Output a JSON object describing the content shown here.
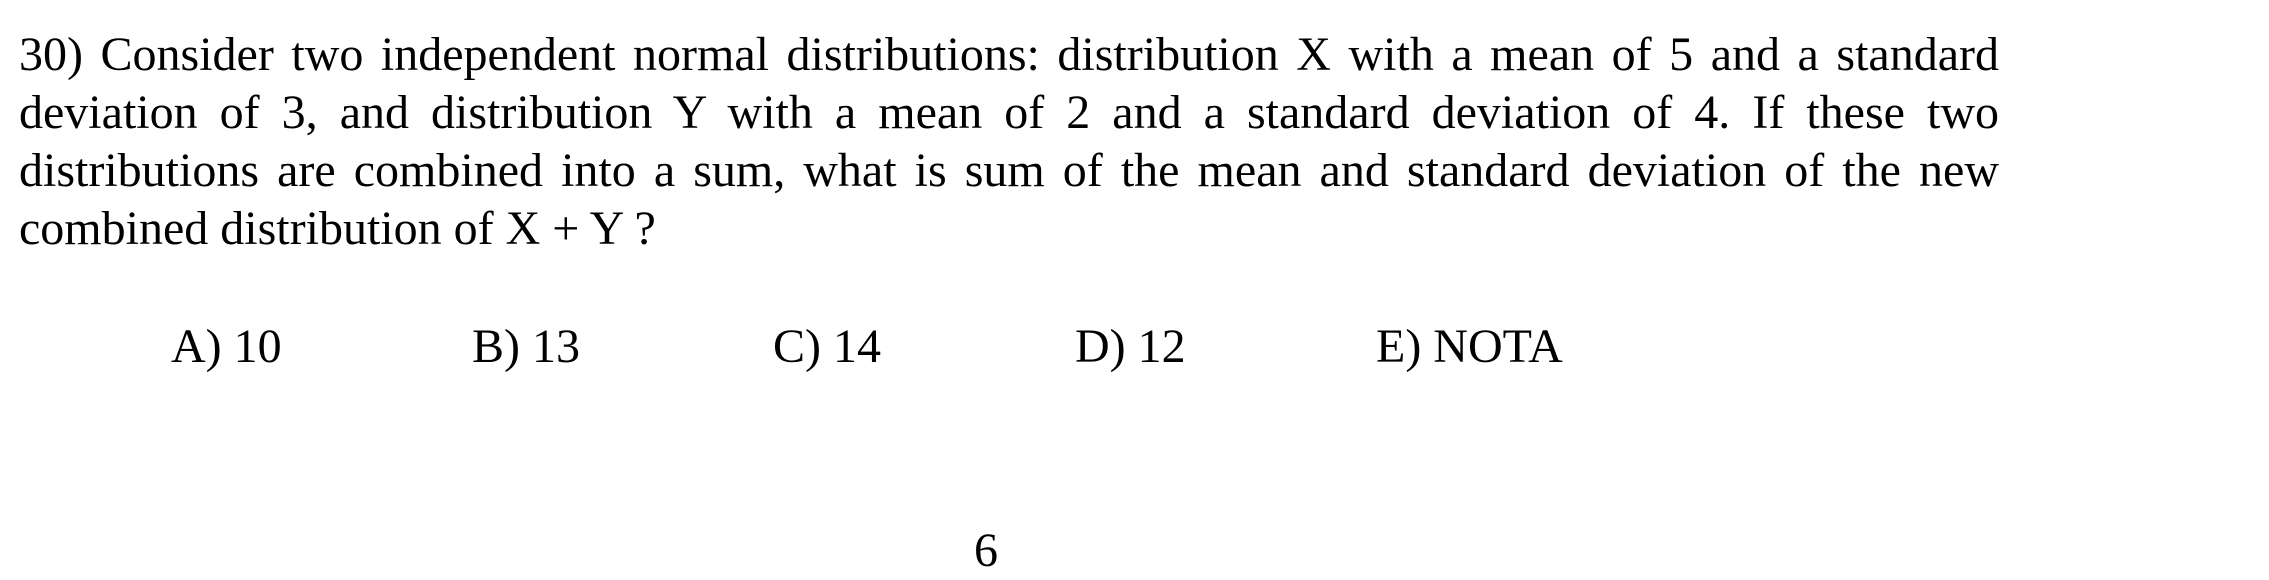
{
  "question": {
    "lines": [
      "30)  Consider two independent normal distributions:  distribution X with a mean of 5 and a standard",
      "deviation of 3, and distribution Y with a mean of 2 and a standard deviation of 4.  If these two",
      "distributions are combined into a sum, what is sum of the mean and standard deviation of the new",
      "combined distribution of X + Y ?"
    ]
  },
  "choices": [
    "A) 10",
    "B) 13",
    "C) 14",
    "D) 12",
    "E) NOTA"
  ],
  "page_number": "6"
}
